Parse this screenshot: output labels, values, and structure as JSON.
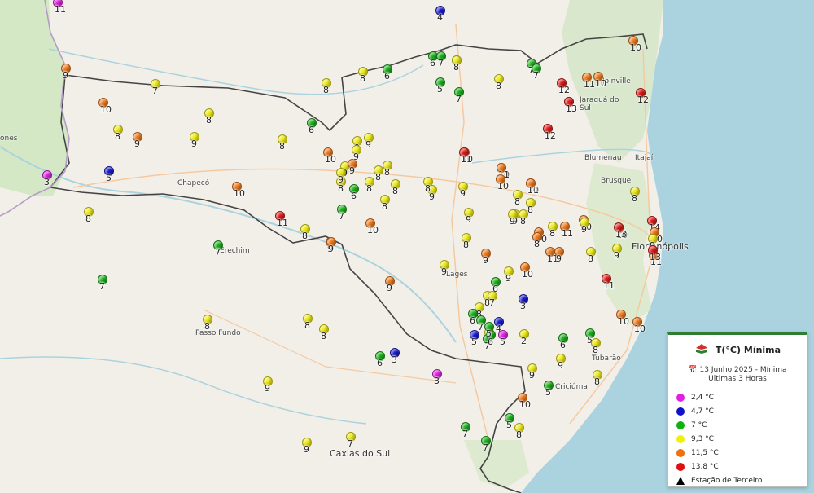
{
  "cities": {
    "chapeco": "Chapecó",
    "erechim": "Erechim",
    "passo_fundo": "Passo Fundo",
    "caxias": "Caxias do Sul",
    "joinville": "Joinville",
    "jaragua": "Jaraguá do Sul",
    "blumenau": "Blumenau",
    "itajai": "Itajaí",
    "brusque": "Brusque",
    "florianopolis": "Florianópolis",
    "lages": "Lages",
    "tubarao": "Tubarão",
    "torres": "Torres",
    "criciuma": "Criciúma",
    "ones": "ones"
  },
  "legend": {
    "title": "T(°C) Mínima",
    "date": "13 Junho 2025 - Mínima Últimas 3 Horas",
    "items": [
      {
        "label": "2,4 °C",
        "color": "#e020e0"
      },
      {
        "label": "4,7 °C",
        "color": "#1010c8"
      },
      {
        "label": "7 °C",
        "color": "#10b010"
      },
      {
        "label": "9,3 °C",
        "color": "#f0f010"
      },
      {
        "label": "11,5 °C",
        "color": "#f07010"
      },
      {
        "label": "13,8 °C",
        "color": "#e01010"
      }
    ],
    "third_party": "Estação de Terceiro"
  },
  "colors": {
    "magenta": "#e020e0",
    "blue": "#1818d0",
    "green": "#18b018",
    "yellow": "#f0ec10",
    "orange": "#f07818",
    "red": "#e01818",
    "sea": "#aad3df",
    "land": "#f2efe9",
    "forest": "#cfe6c0",
    "border": "#444444"
  },
  "stations": [
    {
      "t": "11",
      "c": "magenta"
    },
    {
      "t": "4",
      "c": "blue"
    },
    {
      "t": "9",
      "c": "orange"
    },
    {
      "t": "7",
      "c": "yellow"
    },
    {
      "t": "10",
      "c": "orange"
    },
    {
      "t": "8",
      "c": "yellow"
    },
    {
      "t": "9",
      "c": "orange"
    },
    {
      "t": "9",
      "c": "yellow"
    },
    {
      "t": "8",
      "c": "yellow"
    },
    {
      "t": "8",
      "c": "yellow"
    },
    {
      "t": "5",
      "c": "blue"
    },
    {
      "t": "3",
      "c": "magenta"
    },
    {
      "t": "10",
      "c": "orange"
    },
    {
      "t": "8",
      "c": "yellow"
    },
    {
      "t": "11",
      "c": "red"
    },
    {
      "t": "7",
      "c": "green"
    },
    {
      "t": "7",
      "c": "green"
    },
    {
      "t": "8",
      "c": "yellow"
    },
    {
      "t": "9",
      "c": "orange"
    },
    {
      "t": "8",
      "c": "yellow"
    },
    {
      "t": "8",
      "c": "yellow"
    },
    {
      "t": "8",
      "c": "yellow"
    },
    {
      "t": "8",
      "c": "yellow"
    },
    {
      "t": "6",
      "c": "green"
    },
    {
      "t": "6",
      "c": "green"
    },
    {
      "t": "8",
      "c": "yellow"
    },
    {
      "t": "8",
      "c": "yellow"
    },
    {
      "t": "9",
      "c": "yellow"
    },
    {
      "t": "9",
      "c": "yellow"
    },
    {
      "t": "10",
      "c": "orange"
    },
    {
      "t": "9",
      "c": "yellow"
    },
    {
      "t": "9",
      "c": "orange"
    },
    {
      "t": "9",
      "c": "yellow"
    },
    {
      "t": "8",
      "c": "yellow"
    },
    {
      "t": "8",
      "c": "yellow"
    },
    {
      "t": "9",
      "c": "yellow"
    },
    {
      "t": "6",
      "c": "green"
    },
    {
      "t": "8",
      "c": "yellow"
    },
    {
      "t": "8",
      "c": "yellow"
    },
    {
      "t": "9",
      "c": "yellow"
    },
    {
      "t": "7",
      "c": "green"
    },
    {
      "t": "10",
      "c": "orange"
    },
    {
      "t": "9",
      "c": "orange"
    },
    {
      "t": "8",
      "c": "yellow"
    },
    {
      "t": "6",
      "c": "green"
    },
    {
      "t": "7",
      "c": "green"
    },
    {
      "t": "5",
      "c": "green"
    },
    {
      "t": "7",
      "c": "green"
    },
    {
      "t": "7",
      "c": "green"
    },
    {
      "t": "8",
      "c": "yellow"
    },
    {
      "t": "7",
      "c": "green"
    },
    {
      "t": "10",
      "c": "orange"
    },
    {
      "t": "9",
      "c": "yellow"
    },
    {
      "t": "8",
      "c": "yellow"
    },
    {
      "t": "10",
      "c": "orange"
    },
    {
      "t": "10",
      "c": "orange"
    },
    {
      "t": "9",
      "c": "yellow"
    },
    {
      "t": "9",
      "c": "yellow"
    },
    {
      "t": "8",
      "c": "yellow"
    },
    {
      "t": "9",
      "c": "yellow"
    },
    {
      "t": "8",
      "c": "yellow"
    },
    {
      "t": "8",
      "c": "yellow"
    },
    {
      "t": "6",
      "c": "green"
    },
    {
      "t": "3",
      "c": "blue"
    },
    {
      "t": "3",
      "c": "magenta"
    },
    {
      "t": "9",
      "c": "yellow"
    },
    {
      "t": "7",
      "c": "yellow"
    },
    {
      "t": "9",
      "c": "yellow"
    },
    {
      "t": "10",
      "c": "orange"
    },
    {
      "t": "8",
      "c": "yellow"
    },
    {
      "t": "11",
      "c": "orange"
    },
    {
      "t": "10",
      "c": "orange"
    },
    {
      "t": "11",
      "c": "orange"
    },
    {
      "t": "9",
      "c": "orange"
    },
    {
      "t": "8",
      "c": "yellow"
    },
    {
      "t": "8",
      "c": "orange"
    },
    {
      "t": "9",
      "c": "yellow"
    },
    {
      "t": "8",
      "c": "yellow"
    },
    {
      "t": "10",
      "c": "orange"
    },
    {
      "t": "9",
      "c": "orange"
    },
    {
      "t": "9",
      "c": "yellow"
    },
    {
      "t": "9",
      "c": "orange"
    },
    {
      "t": "9",
      "c": "yellow"
    },
    {
      "t": "8",
      "c": "yellow"
    },
    {
      "t": "8",
      "c": "yellow"
    },
    {
      "t": "3",
      "c": "blue"
    },
    {
      "t": "6",
      "c": "green"
    },
    {
      "t": "7",
      "c": "yellow"
    },
    {
      "t": "4",
      "c": "blue"
    },
    {
      "t": "6",
      "c": "green"
    },
    {
      "t": "8",
      "c": "yellow"
    },
    {
      "t": "7",
      "c": "green"
    },
    {
      "t": "5",
      "c": "blue"
    },
    {
      "t": "6",
      "c": "green"
    },
    {
      "t": "5",
      "c": "magenta"
    },
    {
      "t": "2",
      "c": "yellow"
    },
    {
      "t": "5",
      "c": "green"
    },
    {
      "t": "5",
      "c": "green"
    },
    {
      "t": "5",
      "c": "green"
    },
    {
      "t": "8",
      "c": "yellow"
    },
    {
      "t": "10",
      "c": "orange"
    },
    {
      "t": "7",
      "c": "green"
    },
    {
      "t": "7",
      "c": "green"
    },
    {
      "t": "8",
      "c": "yellow"
    },
    {
      "t": "9",
      "c": "yellow"
    },
    {
      "t": "8",
      "c": "yellow"
    },
    {
      "t": "6",
      "c": "green"
    },
    {
      "t": "9",
      "c": "yellow"
    },
    {
      "t": "10",
      "c": "orange"
    },
    {
      "t": "10",
      "c": "orange"
    },
    {
      "t": "11",
      "c": "red"
    },
    {
      "t": "8",
      "c": "yellow"
    },
    {
      "t": "10",
      "c": "orange"
    },
    {
      "t": "14",
      "c": "red"
    },
    {
      "t": "11",
      "c": "orange"
    },
    {
      "t": "10",
      "c": "orange"
    },
    {
      "t": "9",
      "c": "yellow"
    },
    {
      "t": "9",
      "c": "yellow"
    },
    {
      "t": "13",
      "c": "red"
    },
    {
      "t": "12",
      "c": "red"
    },
    {
      "t": "11",
      "c": "red"
    },
    {
      "t": "11",
      "c": "orange"
    },
    {
      "t": "11",
      "c": "orange"
    },
    {
      "t": "10",
      "c": "orange"
    },
    {
      "t": "11",
      "c": "orange"
    },
    {
      "t": "10",
      "c": "orange"
    },
    {
      "t": "12",
      "c": "red"
    },
    {
      "t": "12",
      "c": "red"
    },
    {
      "t": "13",
      "c": "red"
    },
    {
      "t": "13",
      "c": "red"
    },
    {
      "t": "13",
      "c": "red"
    },
    {
      "t": "10",
      "c": "orange"
    },
    {
      "t": "7",
      "c": "green"
    },
    {
      "t": "8",
      "c": "yellow"
    },
    {
      "t": "5",
      "c": "green"
    },
    {
      "t": "7",
      "c": "green"
    },
    {
      "t": "12",
      "c": "red"
    },
    {
      "t": "13",
      "c": "red"
    },
    {
      "t": "6",
      "c": "yellow"
    }
  ]
}
